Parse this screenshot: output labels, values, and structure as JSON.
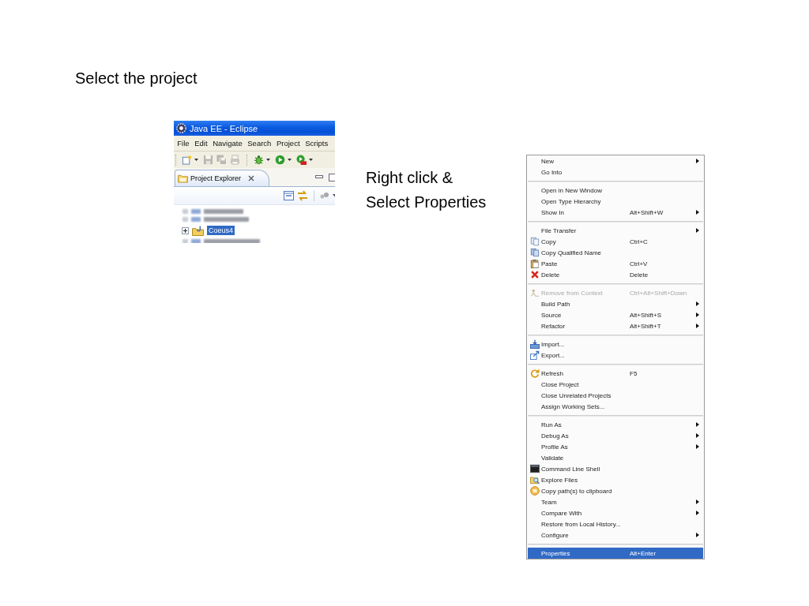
{
  "slide": {
    "title": "Select the project",
    "instruction": "Right click &\nSelect Properties"
  },
  "eclipse": {
    "window_title": "Java EE - Eclipse",
    "menu_bar": [
      "File",
      "Edit",
      "Navigate",
      "Search",
      "Project",
      "Scripts"
    ],
    "toolbar_groups": [
      [
        {
          "kind": "new",
          "dropdown": true,
          "disabled": false
        },
        {
          "kind": "save",
          "dropdown": false,
          "disabled": true
        },
        {
          "kind": "save-all",
          "dropdown": false,
          "disabled": true
        },
        {
          "kind": "print",
          "dropdown": false,
          "disabled": true
        }
      ],
      [
        {
          "kind": "debug",
          "dropdown": true,
          "disabled": false
        },
        {
          "kind": "run",
          "dropdown": true,
          "disabled": false
        },
        {
          "kind": "external-tools",
          "dropdown": true,
          "disabled": false
        }
      ]
    ],
    "view_tab": {
      "label": "Project Explorer",
      "selected": true
    },
    "tree": [
      {
        "kind": "blurred",
        "selected": false
      },
      {
        "kind": "blurred",
        "selected": false
      },
      {
        "kind": "project",
        "label": "Coeus4",
        "expanded": false,
        "selected": true
      },
      {
        "kind": "blurred",
        "selected": false
      }
    ]
  },
  "context_menu": {
    "groups": [
      {
        "items": [
          {
            "kind": "plain",
            "label": "New",
            "submenu": true,
            "disabled": false,
            "selected": false
          },
          {
            "kind": "plain",
            "label": "Go Into",
            "submenu": false,
            "disabled": false,
            "selected": false
          }
        ]
      },
      {
        "items": [
          {
            "kind": "plain",
            "label": "Open in New Window",
            "submenu": false,
            "disabled": false,
            "selected": false
          },
          {
            "kind": "plain",
            "label": "Open Type Hierarchy",
            "submenu": false,
            "disabled": false,
            "selected": false
          },
          {
            "kind": "plain",
            "label": "Show In",
            "shortcut": "Alt+Shift+W",
            "submenu": true,
            "disabled": false,
            "selected": false
          }
        ]
      },
      {
        "items": [
          {
            "kind": "plain",
            "label": "File Transfer",
            "submenu": true,
            "disabled": false,
            "selected": false
          },
          {
            "kind": "copy",
            "label": "Copy",
            "shortcut": "Ctrl+C",
            "submenu": false,
            "disabled": false,
            "selected": false
          },
          {
            "kind": "copy-name",
            "label": "Copy Qualified Name",
            "submenu": false,
            "disabled": false,
            "selected": false
          },
          {
            "kind": "paste",
            "label": "Paste",
            "shortcut": "Ctrl+V",
            "submenu": false,
            "disabled": false,
            "selected": false
          },
          {
            "kind": "delete",
            "label": "Delete",
            "shortcut": "Delete",
            "submenu": false,
            "disabled": false,
            "selected": false
          }
        ]
      },
      {
        "items": [
          {
            "kind": "context",
            "label": "Remove from Context",
            "shortcut": "Ctrl+Alt+Shift+Down",
            "submenu": false,
            "disabled": true,
            "selected": false
          },
          {
            "kind": "plain",
            "label": "Build Path",
            "submenu": true,
            "disabled": false,
            "selected": false
          },
          {
            "kind": "plain",
            "label": "Source",
            "shortcut": "Alt+Shift+S",
            "submenu": true,
            "disabled": false,
            "selected": false
          },
          {
            "kind": "plain",
            "label": "Refactor",
            "shortcut": "Alt+Shift+T",
            "submenu": true,
            "disabled": false,
            "selected": false
          }
        ]
      },
      {
        "items": [
          {
            "kind": "import",
            "label": "Import...",
            "submenu": false,
            "disabled": false,
            "selected": false
          },
          {
            "kind": "export",
            "label": "Export...",
            "submenu": false,
            "disabled": false,
            "selected": false
          }
        ]
      },
      {
        "items": [
          {
            "kind": "refresh",
            "label": "Refresh",
            "shortcut": "F5",
            "submenu": false,
            "disabled": false,
            "selected": false
          },
          {
            "kind": "plain",
            "label": "Close Project",
            "submenu": false,
            "disabled": false,
            "selected": false
          },
          {
            "kind": "plain",
            "label": "Close Unrelated Projects",
            "submenu": false,
            "disabled": false,
            "selected": false
          },
          {
            "kind": "plain",
            "label": "Assign Working Sets...",
            "submenu": false,
            "disabled": false,
            "selected": false
          }
        ]
      },
      {
        "items": [
          {
            "kind": "plain",
            "label": "Run As",
            "submenu": true,
            "disabled": false,
            "selected": false
          },
          {
            "kind": "plain",
            "label": "Debug As",
            "submenu": true,
            "disabled": false,
            "selected": false
          },
          {
            "kind": "plain",
            "label": "Profile As",
            "submenu": true,
            "disabled": false,
            "selected": false
          },
          {
            "kind": "plain",
            "label": "Validate",
            "submenu": false,
            "disabled": false,
            "selected": false
          },
          {
            "kind": "terminal",
            "label": "Command Line Shell",
            "submenu": false,
            "disabled": false,
            "selected": false
          },
          {
            "kind": "explore",
            "label": "Explore Files",
            "submenu": false,
            "disabled": false,
            "selected": false
          },
          {
            "kind": "copy-path",
            "label": "Copy path(s) to clipboard",
            "submenu": false,
            "disabled": false,
            "selected": false
          },
          {
            "kind": "plain",
            "label": "Team",
            "submenu": true,
            "disabled": false,
            "selected": false
          },
          {
            "kind": "plain",
            "label": "Compare With",
            "submenu": true,
            "disabled": false,
            "selected": false
          },
          {
            "kind": "plain",
            "label": "Restore from Local History...",
            "submenu": false,
            "disabled": false,
            "selected": false
          },
          {
            "kind": "plain",
            "label": "Configure",
            "submenu": true,
            "disabled": false,
            "selected": false
          }
        ]
      },
      {
        "items": [
          {
            "kind": "plain",
            "label": "Properties",
            "shortcut": "Alt+Enter",
            "submenu": false,
            "disabled": false,
            "selected": true
          }
        ]
      }
    ]
  }
}
